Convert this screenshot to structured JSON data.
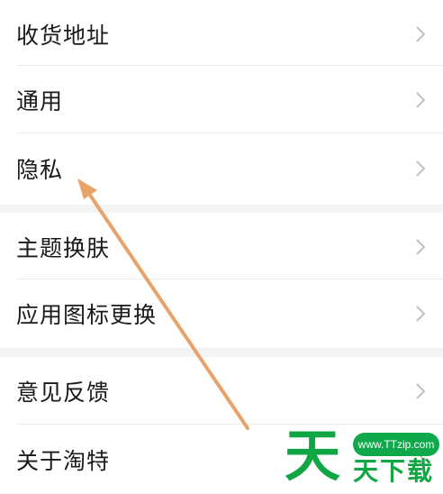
{
  "settings": {
    "group1": [
      {
        "label": "收货地址"
      },
      {
        "label": "通用"
      },
      {
        "label": "隐私"
      }
    ],
    "group2": [
      {
        "label": "主题换肤"
      },
      {
        "label": "应用图标更换"
      }
    ],
    "group3": [
      {
        "label": "意见反馈"
      },
      {
        "label": "关于淘特"
      }
    ]
  },
  "watermark": {
    "url": "www.TTzip.com",
    "big_char": "天",
    "brand": "天下载"
  },
  "colors": {
    "arrow": "#e8a36a",
    "watermark_green": "#11a644",
    "chevron": "#c2c2c2",
    "section_gap": "#f4f4f4"
  }
}
